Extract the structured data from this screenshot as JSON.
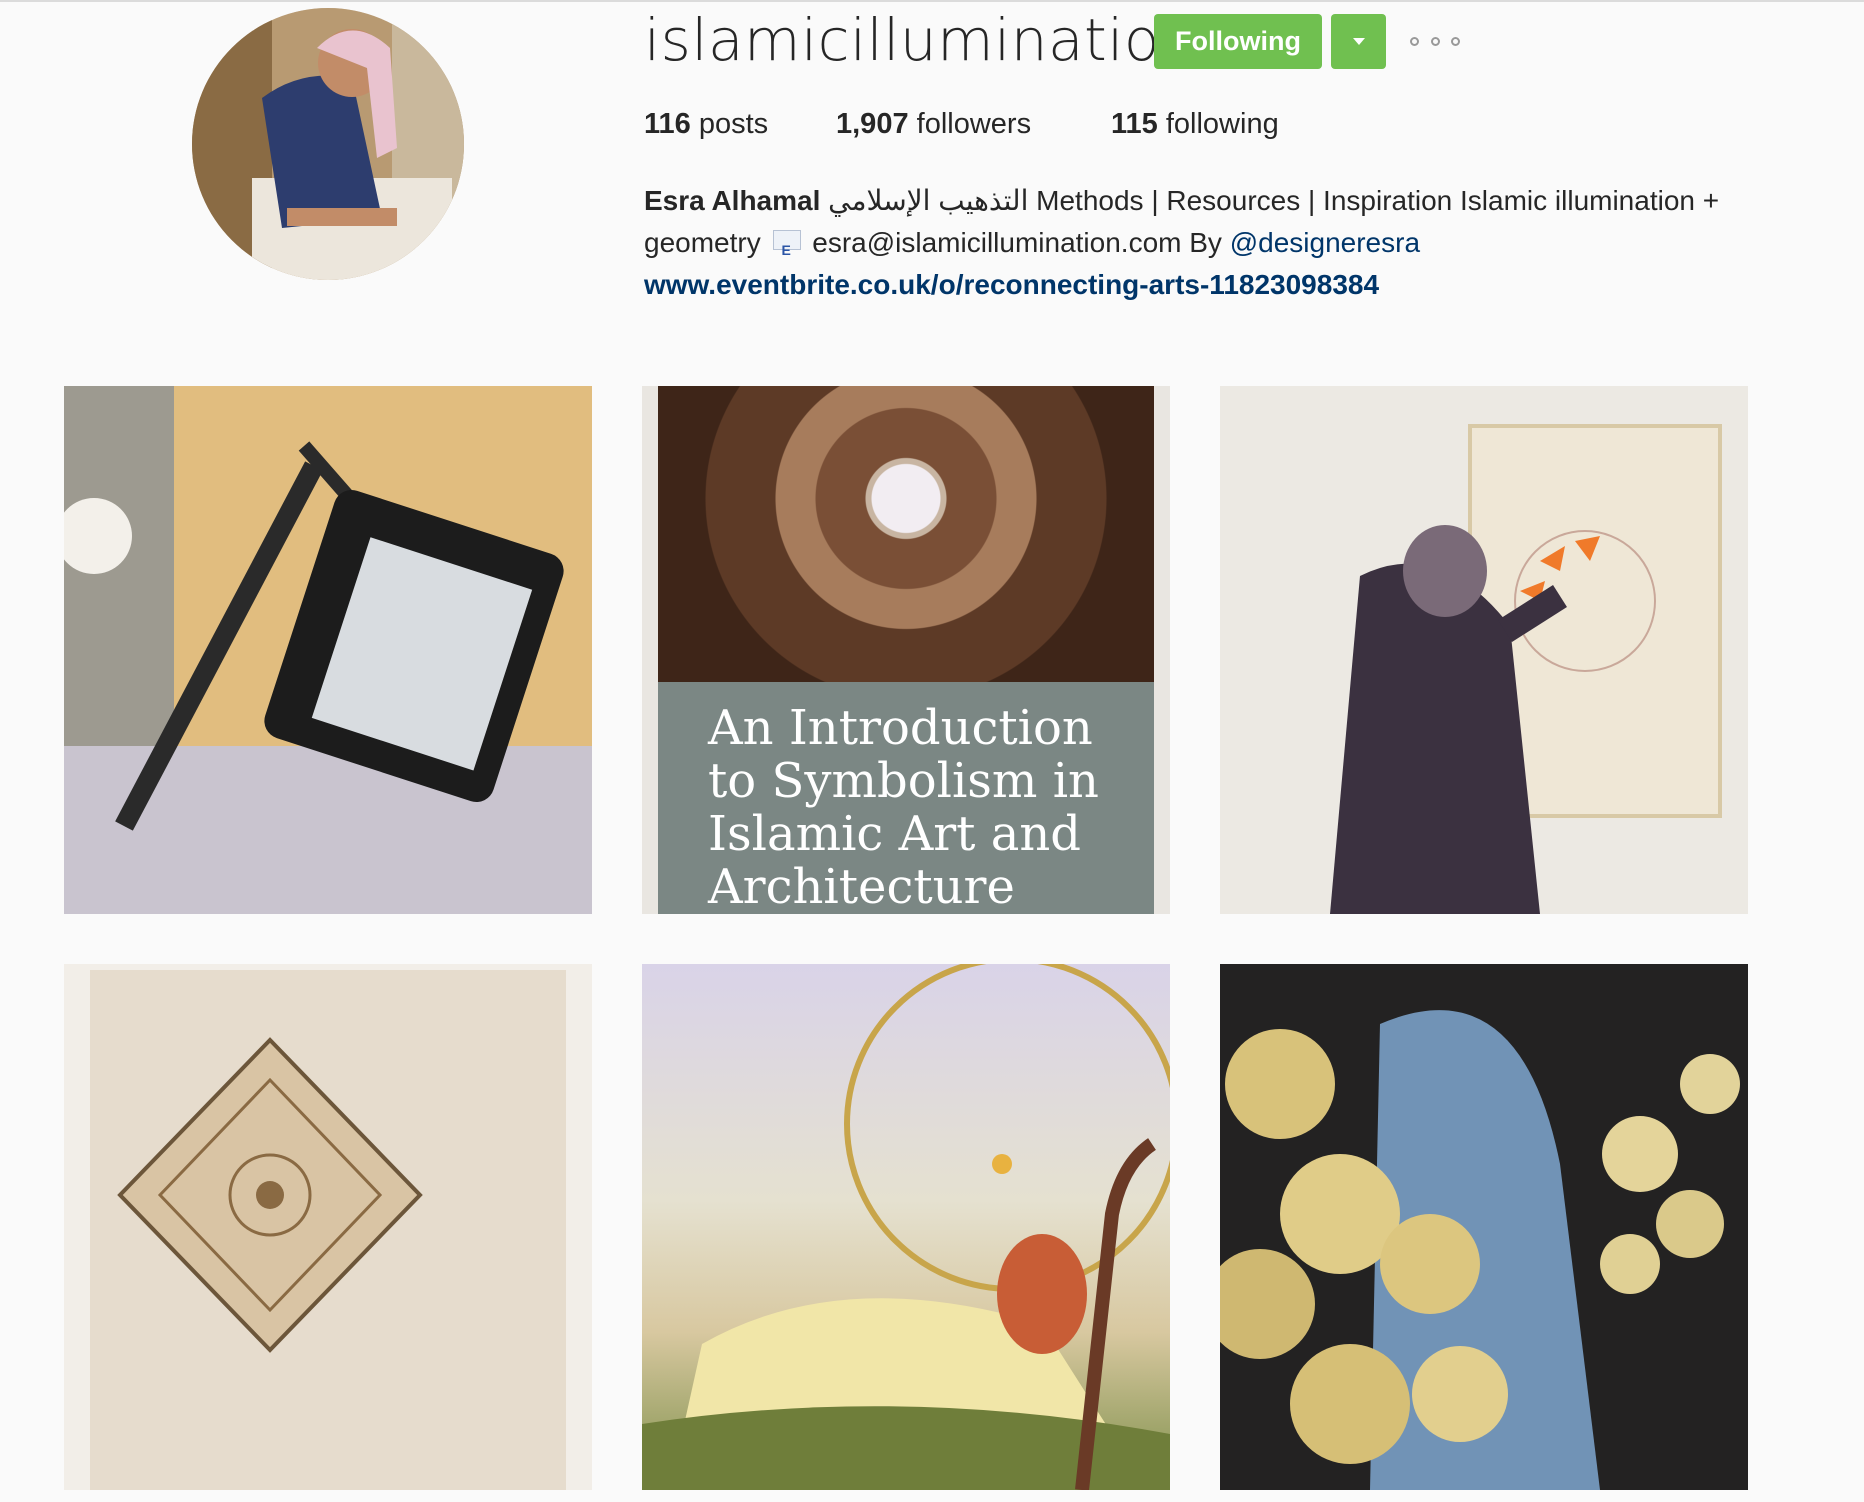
{
  "profile": {
    "username": "islamicillumination",
    "following_button": "Following",
    "stats": {
      "posts_count": "116",
      "posts_label": " posts",
      "followers_count": "1,907",
      "followers_label": " followers",
      "following_count": "115",
      "following_label": " following"
    },
    "bio": {
      "name": "Esra Alhamal",
      "text1": " التذهيب الإسلامي Methods | Resources | Inspiration Islamic illumination + geometry ",
      "email_text": " esra@islamicillumination.com By ",
      "mention": "@designeresra",
      "link": "www.eventbrite.co.uk/o/reconnecting-arts-11823098384"
    }
  },
  "posts": [
    {
      "title": ""
    },
    {
      "title": "An Introduction to Symbolism in Islamic Art and Architecture"
    },
    {
      "title": ""
    },
    {
      "title": ""
    },
    {
      "title": ""
    },
    {
      "title": ""
    }
  ],
  "colors": {
    "following_button": "#70c050",
    "link": "#003569"
  }
}
